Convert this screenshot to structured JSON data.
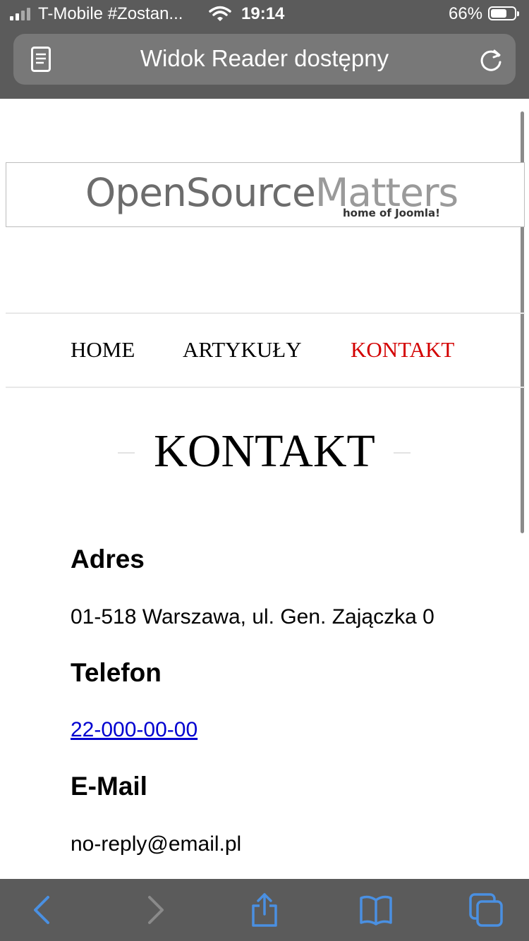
{
  "status_bar": {
    "carrier": "T-Mobile #Zostan...",
    "time": "19:14",
    "battery_percent": "66%",
    "battery_level": 0.66,
    "signal_bars_total": 4,
    "signal_bars_active": 2
  },
  "url_bar": {
    "text": "Widok Reader dostępny",
    "left_icon": "reader-view-icon",
    "right_icon": "reload-icon"
  },
  "logo": {
    "text_part1": "OpenSource",
    "text_part2": "Matters",
    "tagline": "home of Joomla!"
  },
  "nav": {
    "items": [
      {
        "label": "HOME",
        "active": false
      },
      {
        "label": "ARTYKUŁY",
        "active": false
      },
      {
        "label": "KONTAKT",
        "active": true
      }
    ]
  },
  "page": {
    "heading": "KONTAKT",
    "sections": [
      {
        "label": "Adres",
        "value": "01-518 Warszawa, ul. Gen. Zajączka 0"
      },
      {
        "label": "Telefon",
        "value": "22-000-00-00"
      },
      {
        "label": "E-Mail",
        "value": "no-reply@email.pl"
      }
    ]
  },
  "toolbar": {
    "icons": [
      "back-icon",
      "forward-icon",
      "share-icon",
      "bookmarks-icon",
      "tabs-icon"
    ]
  },
  "colors": {
    "chrome": "#5b5b5b",
    "url_bar": "#787878",
    "nav_active": "#d30000",
    "link": "#0000d0",
    "toolbar_icon": "#4a90e2"
  }
}
